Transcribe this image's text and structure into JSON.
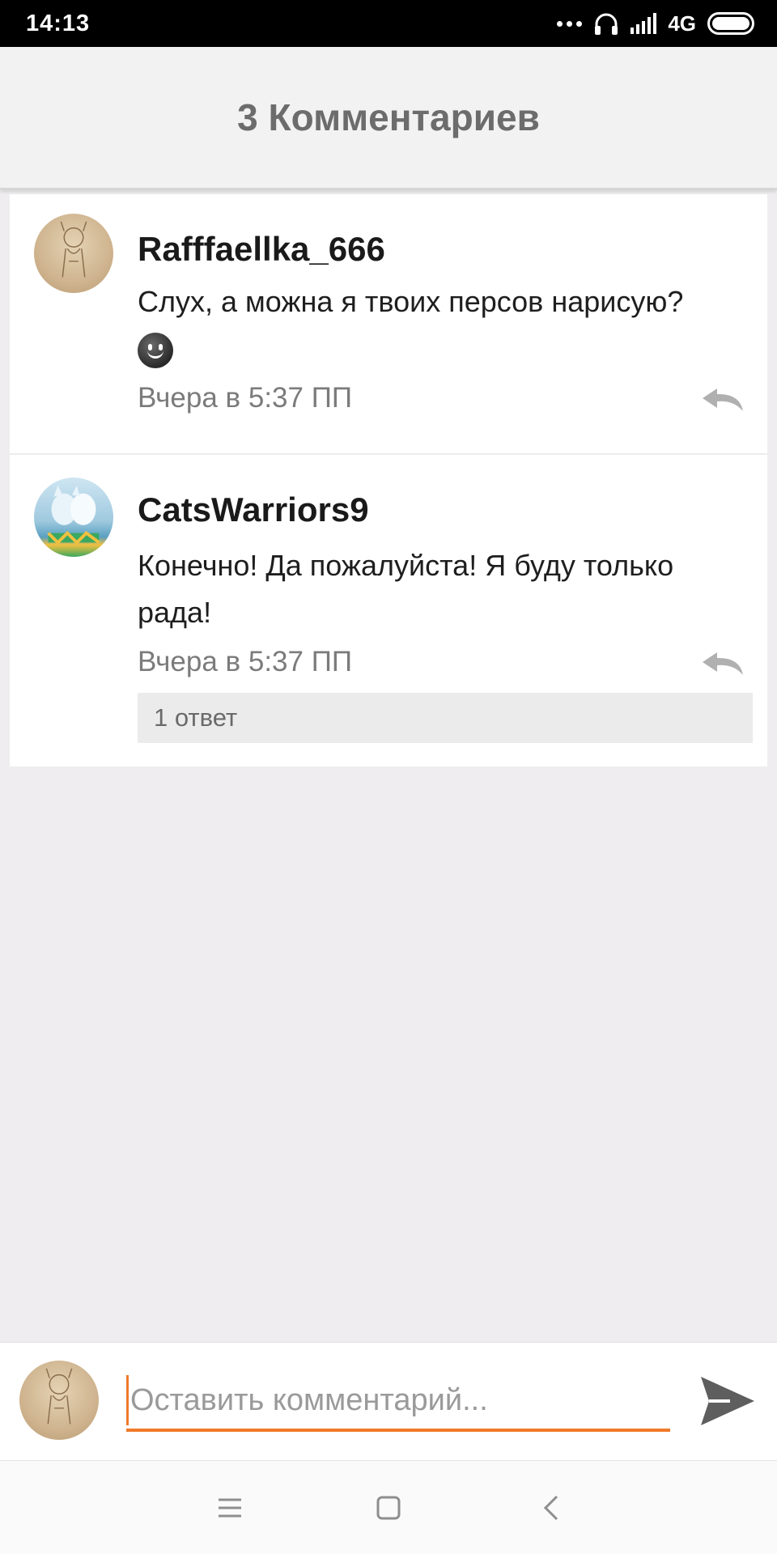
{
  "status_bar": {
    "time": "14:13",
    "network": "4G",
    "icons": [
      "more-dots-icon",
      "headphones-icon",
      "signal-icon",
      "battery-icon"
    ]
  },
  "header": {
    "title": "3 Комментариев"
  },
  "comments": [
    {
      "username": "Rafffaellka_666",
      "text": "Слух, а можна я твоих персов нарисую?",
      "emoji": "smiling-face-icon",
      "timestamp": "Вчера в 5:37 ПП",
      "reply_icon": "reply-arrow-icon"
    },
    {
      "username": "CatsWarriors9",
      "text": "Конечно! Да пожалуйста! Я буду только рада!",
      "timestamp": "Вчера в 5:37 ПП",
      "reply_icon": "reply-arrow-icon",
      "replies_label": "1 ответ"
    }
  ],
  "composer": {
    "placeholder": "Оставить комментарий...",
    "send_icon": "send-icon",
    "accent_color": "#f07a2a"
  },
  "nav_bar": {
    "icons": [
      "menu-icon",
      "home-icon",
      "back-icon"
    ]
  }
}
